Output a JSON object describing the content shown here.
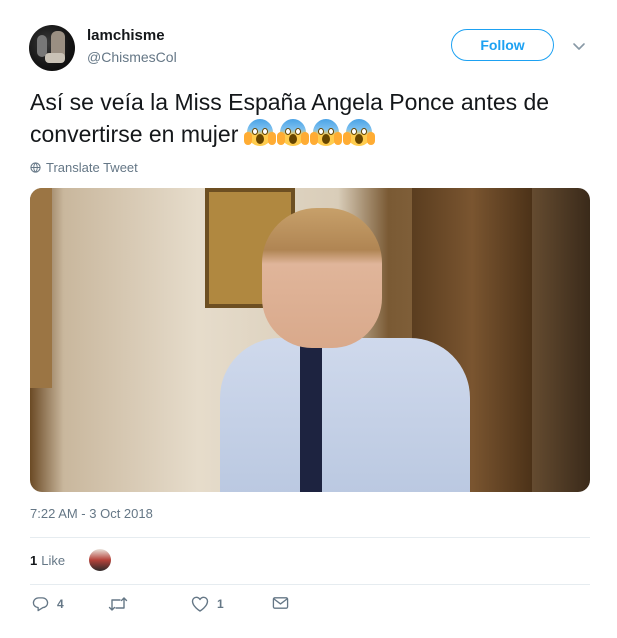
{
  "user": {
    "display_name": "lamchisme",
    "handle": "@ChismesCol"
  },
  "follow_button": {
    "label": "Follow"
  },
  "tweet": {
    "text": "Así se veía la Miss España Angela Ponce antes de convertirse en mujer",
    "emojis": [
      "face-screaming-in-fear",
      "face-screaming-in-fear",
      "face-screaming-in-fear",
      "face-screaming-in-fear"
    ],
    "translate_label": "Translate Tweet",
    "timestamp": "7:22 AM - 3 Oct 2018"
  },
  "engagement": {
    "likes_count": "1",
    "likes_label": "Like"
  },
  "actions": {
    "reply_count": "4",
    "retweet_count": "",
    "like_count": "1"
  },
  "colors": {
    "accent": "#1da1f2",
    "text": "#14171a",
    "secondary": "#657786",
    "divider": "#e6ecf0"
  },
  "icons": {
    "more": "chevron-down-icon",
    "translate": "globe-icon",
    "reply": "reply-icon",
    "retweet": "retweet-icon",
    "like": "heart-icon",
    "message": "envelope-icon"
  }
}
